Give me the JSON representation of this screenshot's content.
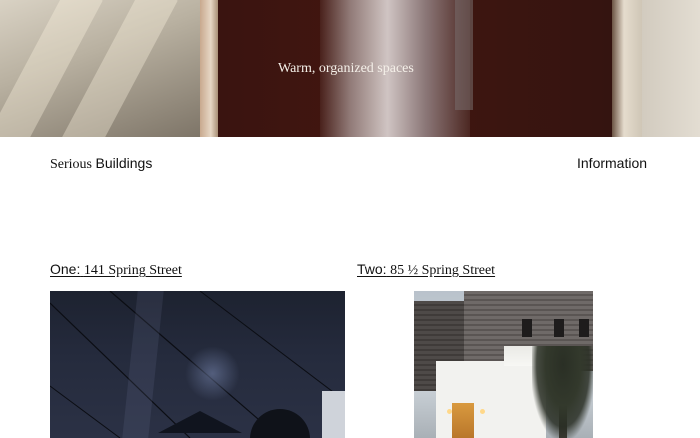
{
  "hero": {
    "caption": "Warm, organized spaces"
  },
  "header": {
    "title_serif": "Serious",
    "title_sans": "Buildings",
    "nav_information": "Information"
  },
  "projects": [
    {
      "number_label": "One:",
      "address": "141 Spring Street"
    },
    {
      "number_label": "Two:",
      "address": "85 ½ Spring Street"
    }
  ]
}
